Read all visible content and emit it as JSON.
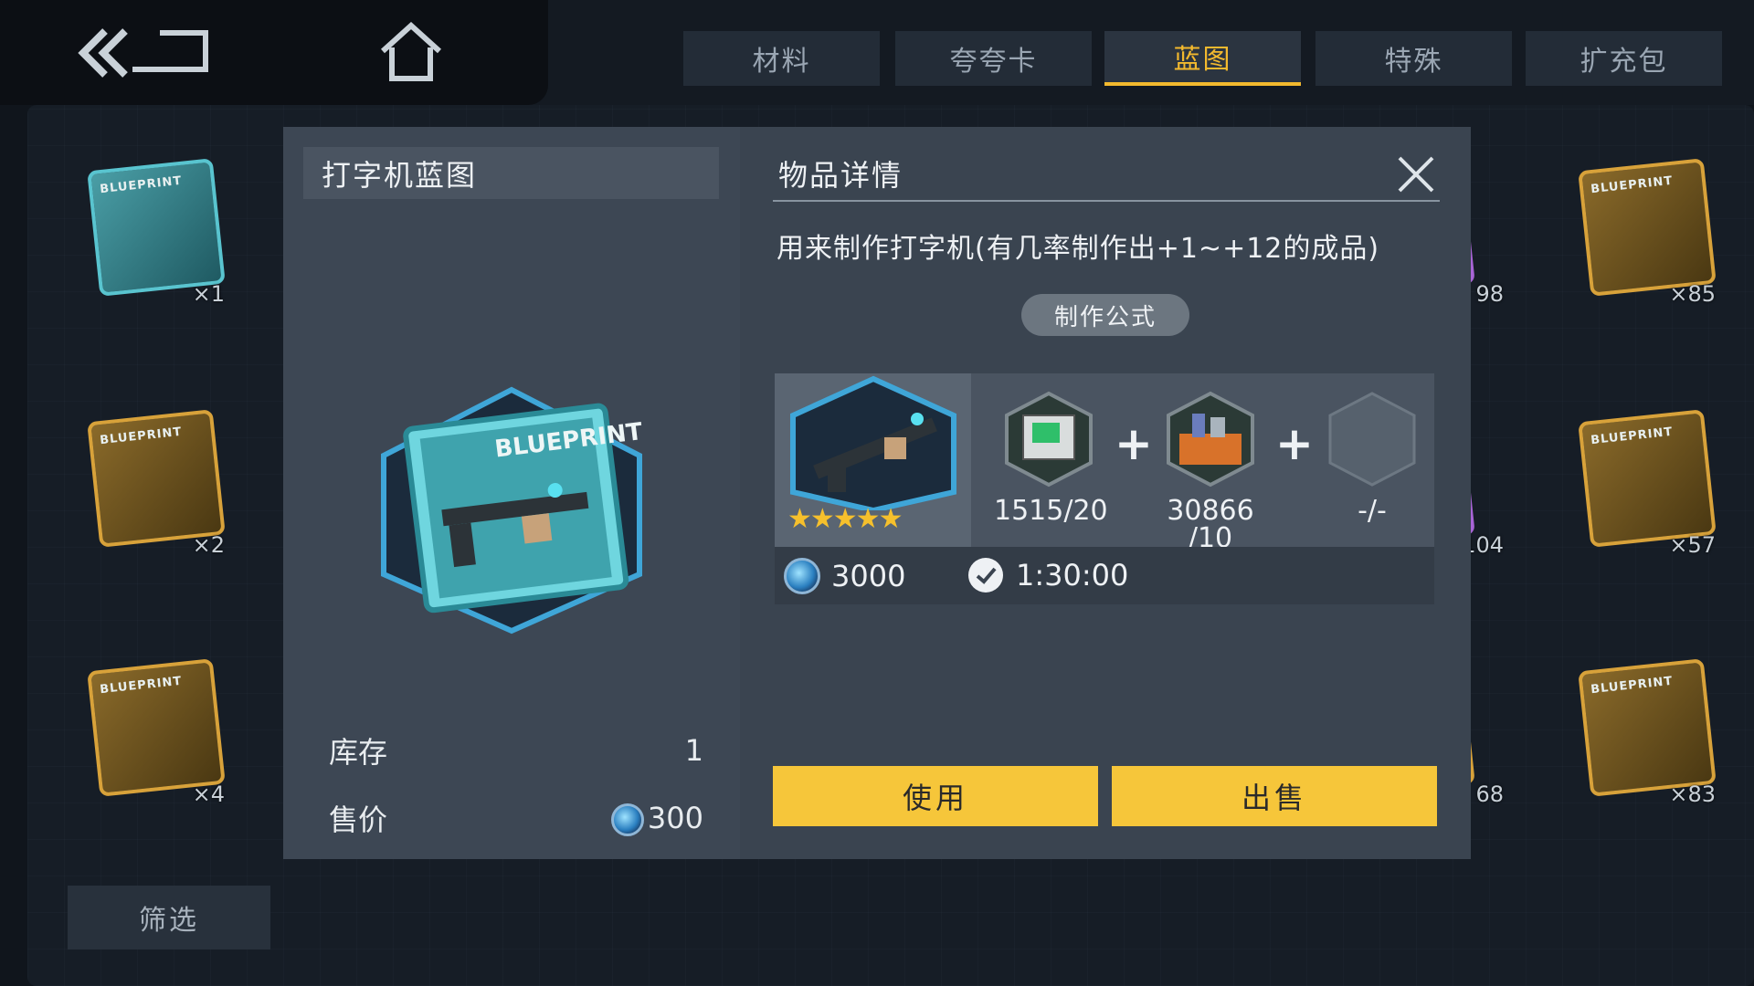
{
  "nav": {
    "back_icon": "double-chevron-left-icon",
    "home_icon": "home-icon"
  },
  "tabs": [
    {
      "label": "材料",
      "active": false
    },
    {
      "label": "夸夸卡",
      "active": false
    },
    {
      "label": "蓝图",
      "active": true
    },
    {
      "label": "特殊",
      "active": false
    },
    {
      "label": "扩充包",
      "active": false
    }
  ],
  "inventory": {
    "left_column": [
      {
        "label": "BLUEPRINT",
        "qty": "×1",
        "color": "#59c4cf"
      },
      {
        "label": "BLUEPRINT",
        "qty": "×2",
        "color": "#d8a23a"
      },
      {
        "label": "BLUEPRINT",
        "qty": "×4",
        "color": "#d8a23a"
      }
    ],
    "right_partial": [
      {
        "qty": "98",
        "color": "#a864d6"
      },
      {
        "qty": "104",
        "color": "#a864d6"
      },
      {
        "qty": "68",
        "color": "#d8a23a"
      }
    ],
    "right_column": [
      {
        "label": "BLUEPRINT",
        "qty": "×85",
        "color": "#d8a23a"
      },
      {
        "label": "BLUEPRINT",
        "qty": "×57",
        "color": "#d8a23a"
      },
      {
        "label": "BLUEPRINT",
        "qty": "×83",
        "color": "#d8a23a"
      }
    ]
  },
  "filter_label": "筛选",
  "dialog": {
    "item_name": "打字机蓝图",
    "big_icon_label": "BLUEPRINT",
    "stock_label": "库存",
    "stock_value": "1",
    "price_label": "售价",
    "price_value": "300",
    "detail_title": "物品详情",
    "close_icon": "close-icon",
    "description": "用来制作打字机(有几率制作出+1~+12的成品)",
    "formula_label": "制作公式",
    "recipe": {
      "result_stars": "★★★★★",
      "ingredients": [
        {
          "count": "1515/20",
          "icon": "green-crate-icon"
        },
        {
          "count": "30866\n/10",
          "icon": "orange-parts-box-icon"
        },
        {
          "count": "-/-",
          "icon": "empty-hex-slot-icon"
        }
      ],
      "plus_sign": "+",
      "cost_value": "3000",
      "time_value": "1:30:00"
    },
    "use_label": "使用",
    "sell_label": "出售"
  },
  "colors": {
    "accent": "#f3b92e",
    "button": "#f6c63a",
    "teal": "#59c4cf"
  }
}
